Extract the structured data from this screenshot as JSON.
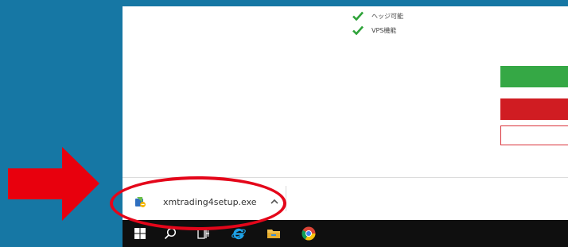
{
  "features": [
    {
      "label": "ヘッジ可能"
    },
    {
      "label": "VPS機能"
    }
  ],
  "download_bar": {
    "file_name": "xmtrading4setup.exe"
  },
  "taskbar": {
    "icons": [
      "windows-start-icon",
      "search-icon",
      "task-view-icon",
      "internet-explorer-icon",
      "file-explorer-icon",
      "chrome-icon"
    ]
  },
  "colors": {
    "desktop": "#1677a4",
    "green_button": "#35a845",
    "red_button": "#d01c22",
    "highlight": "#e4061a"
  }
}
